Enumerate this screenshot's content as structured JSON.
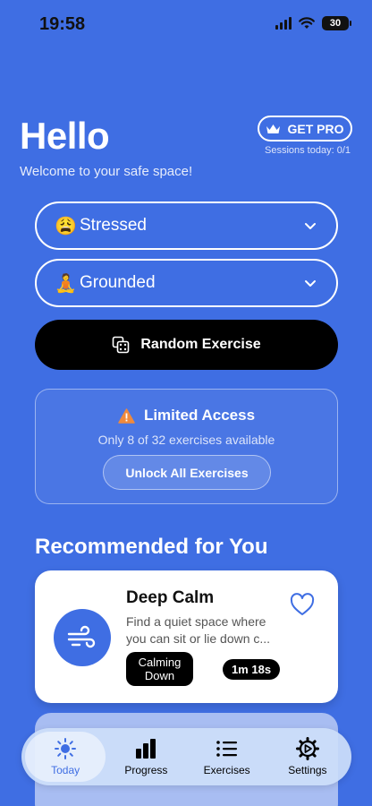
{
  "status": {
    "time": "19:58",
    "battery": "30"
  },
  "header": {
    "title": "Hello",
    "subtitle": "Welcome to your safe space!",
    "pro_button": "GET PRO",
    "sessions": "Sessions today: 0/1"
  },
  "selects": [
    {
      "emoji": "😩",
      "label": "Stressed"
    },
    {
      "emoji": "🧘",
      "label": "Grounded"
    }
  ],
  "random_button": "Random Exercise",
  "limited": {
    "title": "Limited Access",
    "subtitle": "Only 8 of 32 exercises available",
    "unlock_button": "Unlock All Exercises"
  },
  "recommended": {
    "heading": "Recommended for You",
    "card": {
      "title": "Deep Calm",
      "description": "Find a quiet space where you can sit or lie down c...",
      "category": "Calming Down",
      "duration": "1m 18s"
    }
  },
  "tabs": [
    {
      "label": "Today",
      "icon": "sun-icon",
      "active": true
    },
    {
      "label": "Progress",
      "icon": "bar-chart-icon"
    },
    {
      "label": "Exercises",
      "icon": "list-icon"
    },
    {
      "label": "Settings",
      "icon": "gear-icon"
    }
  ],
  "colors": {
    "background": "#3F6EE3",
    "accent": "#3F6EE3"
  }
}
